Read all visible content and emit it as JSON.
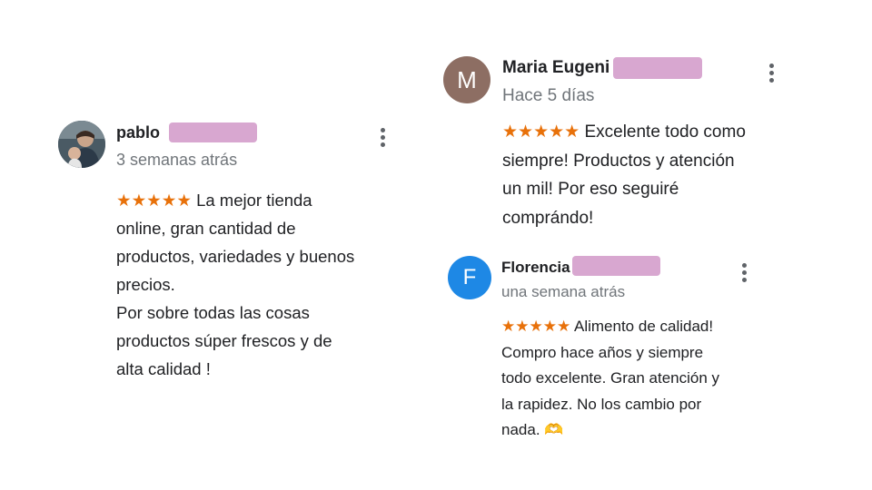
{
  "reviews": [
    {
      "author": "pablo",
      "time": "3 semanas atrás",
      "stars": "★★★★★",
      "text": "La mejor tienda\nonline, gran cantidad de\nproductos, variedades y buenos\nprecios.\nPor sobre todas las cosas\nproductos súper  frescos y de\nalta calidad !"
    },
    {
      "author": "Maria Eugeni",
      "avatar_letter": "M",
      "avatar_color": "#8d6e63",
      "time": "Hace 5 días",
      "stars": "★★★★★",
      "text": "Excelente todo como\nsiempre! Productos y atención\nun mil! Por eso seguiré\ncomprándo!"
    },
    {
      "author": "Florencia",
      "avatar_letter": "F",
      "avatar_color": "#1e88e5",
      "time": "una semana atrás",
      "stars": "★★★★★",
      "text": "Alimento de calidad!\nCompro hace años y siempre\ntodo excelente. Gran atención y\nla rapidez. No los cambio por\nnada. 🫶"
    }
  ],
  "colors": {
    "star": "#e8710a",
    "redaction": "#d8a7d0"
  },
  "icons": [
    "more-vert-icon",
    "star-icon"
  ]
}
